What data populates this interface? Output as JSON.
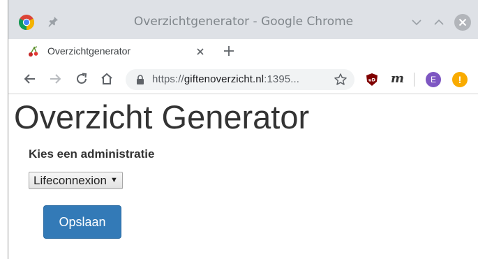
{
  "window": {
    "title": "Overzichtgenerator - Google Chrome"
  },
  "tabs": [
    {
      "label": "Overzichtgenerator",
      "active": true
    }
  ],
  "address_bar": {
    "scheme": "https://",
    "host": "giftenoverzicht.nl",
    "rest": ":1395..."
  },
  "extensions": {
    "ublock_label": "uD",
    "m_label": "m",
    "avatar_initial": "E",
    "update_badge": "!"
  },
  "page": {
    "title": "Overzicht Generator",
    "field_label": "Kies een administratie",
    "select": {
      "selected": "Lifeconnexion",
      "arrow": "▼"
    },
    "save_button": "Opslaan"
  },
  "colors": {
    "titlebar": "#dee1e6",
    "primary_button": "#337ab7",
    "avatar": "#7e57c2",
    "update_badge": "#f9ab00",
    "ublock": "#800000"
  }
}
